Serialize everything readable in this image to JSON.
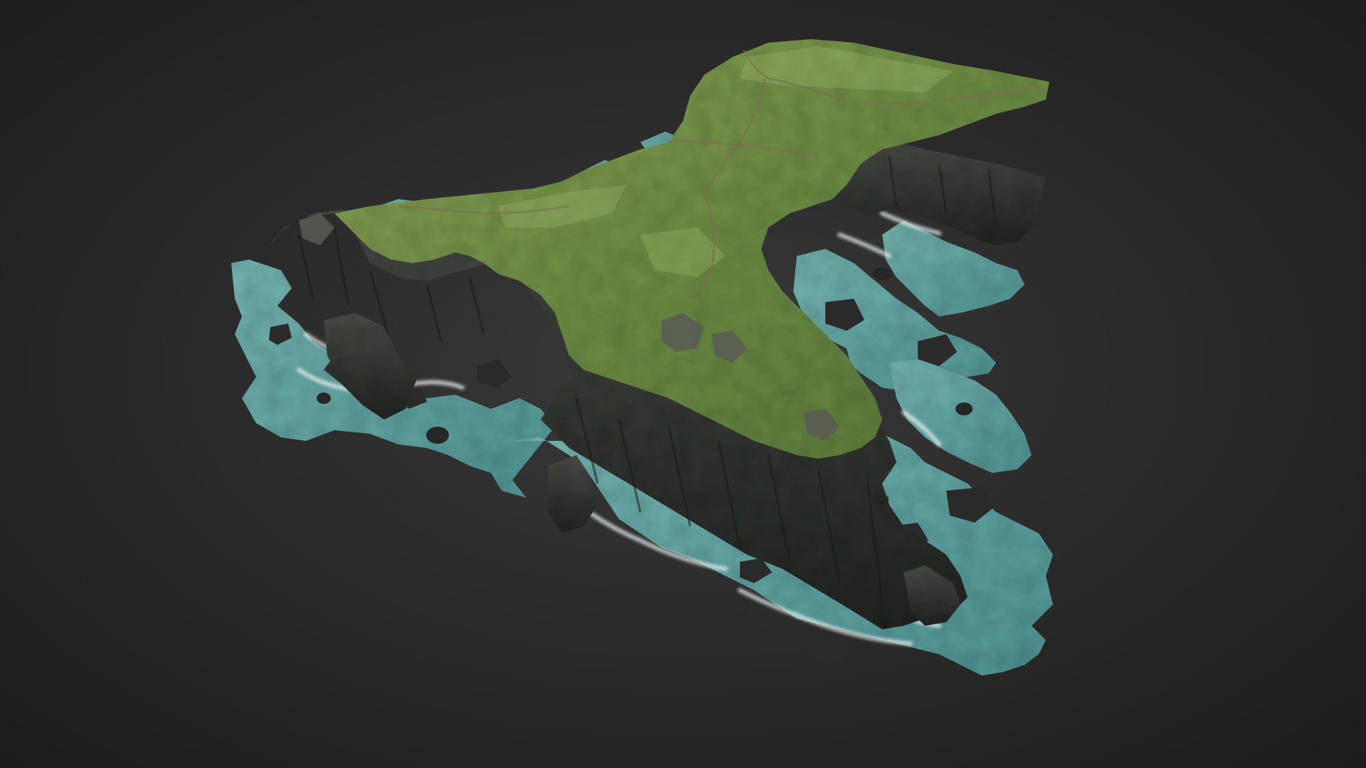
{
  "scene": {
    "subject": "photogrammetry-coastal-headland",
    "icon": "model-3d",
    "colors": {
      "background": "#2a2a2a",
      "grass": "#6f8f45",
      "grass_light": "#8aa356",
      "rock": "#3b3d3a",
      "rock_dark": "#222422",
      "sea": "#5fa6a4",
      "sea_light": "#86c2bd",
      "foam": "#e6f1ef"
    }
  }
}
